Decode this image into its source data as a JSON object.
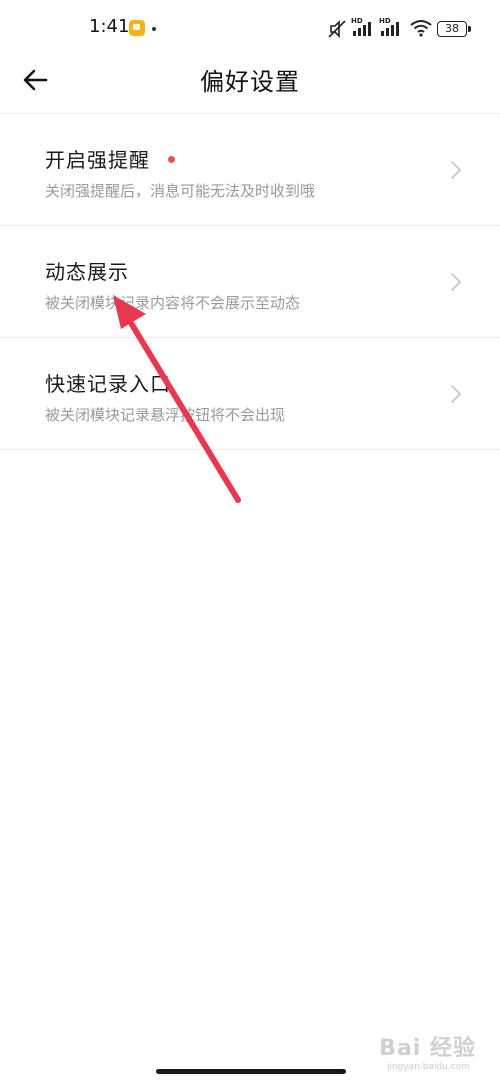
{
  "status_bar": {
    "time": "1:41",
    "battery": "38",
    "icons": [
      "app-notification-icon",
      "dot-icon",
      "mute-icon",
      "signal-hd-icon",
      "signal-hd-icon",
      "wifi-icon",
      "battery-icon"
    ]
  },
  "header": {
    "title": "偏好设置",
    "back_icon": "back-arrow-icon"
  },
  "settings": [
    {
      "title": "开启强提醒",
      "desc": "关闭强提醒后，消息可能无法及时收到哦",
      "has_red_dot": true
    },
    {
      "title": "动态展示",
      "desc": "被关闭模块记录内容将不会展示至动态",
      "has_red_dot": false
    },
    {
      "title": "快速记录入口",
      "desc": "被关闭模块记录悬浮按钮将不会出现",
      "has_red_dot": false
    }
  ],
  "colors": {
    "red_dot": "#e0584b",
    "annotation_arrow": "#e8384f",
    "desc_text": "#9a9a9a"
  },
  "watermark": {
    "text": "Bai 经验",
    "sub": "jingyan.baidu.com"
  }
}
